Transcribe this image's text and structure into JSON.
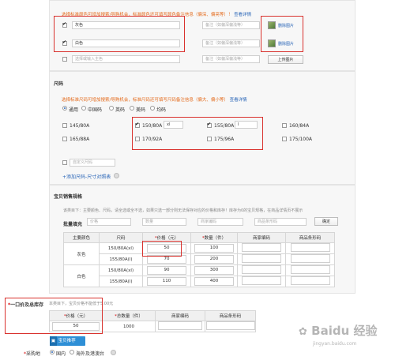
{
  "color_section": {
    "hint_text": "选择标准颜色可增加搜索/导购机会，标准颜色还可填写颜色备注信息（偏深、偏亮等）！",
    "hint_link": "查看详情",
    "rows": [
      {
        "checked": true,
        "name": "灰色",
        "remark_placeholder": "备注（如偏深偏浅等）",
        "image_label": "删除图片"
      },
      {
        "checked": true,
        "name": "白色",
        "remark_placeholder": "备注（如偏深偏浅等）",
        "image_label": "删除图片"
      },
      {
        "checked": false,
        "name": "选择或输入主色",
        "remark_placeholder": "备注（如偏深偏浅等）",
        "image_label": "上传图片"
      }
    ]
  },
  "size_section": {
    "title": "尺码",
    "hint_text": "选择标准尺码可增加搜索/导购机会，标准尺码还可填写尺码备注信息（偏大、偏小等）",
    "hint_link": "查看详情",
    "radios": [
      {
        "label": "通用",
        "checked": true
      },
      {
        "label": "中国码",
        "checked": false
      },
      {
        "label": "英码",
        "checked": false
      },
      {
        "label": "美码",
        "checked": false
      },
      {
        "label": "均码",
        "checked": false
      }
    ],
    "sizes": [
      {
        "label": "145/80A",
        "checked": false
      },
      {
        "label": "150/80A",
        "checked": true,
        "remark": "xl"
      },
      {
        "label": "155/80A",
        "checked": true,
        "remark": "l"
      },
      {
        "label": "160/84A",
        "checked": false
      },
      {
        "label": "165/88A",
        "checked": false
      },
      {
        "label": "170/92A",
        "checked": false
      },
      {
        "label": "175/96A",
        "checked": false
      },
      {
        "label": "175/100A",
        "checked": false
      }
    ],
    "custom_label": "自定义尺码",
    "add_link": "+添加尺码-尺寸对照表"
  },
  "sale_spec": {
    "title": "宝贝销售规格",
    "desc": "该类目下：主要颜色、尺码，请全选或全不选，如果只选一部分则无法保存对应的价格和库存！库存为0的宝贝规格，在商品详情页不展示",
    "batch_label": "批量填充",
    "batch_price_placeholder": "价格",
    "batch_qty_placeholder": "数量",
    "batch_code_placeholder": "商家编码",
    "batch_barcode_placeholder": "商品条形码",
    "confirm_label": "确定",
    "headers": [
      "主要颜色",
      "尺码",
      "价格（元）",
      "数量（件）",
      "商家编码",
      "商品条形码"
    ],
    "rows": [
      {
        "color": "灰色",
        "size": "150/80A(xl)",
        "price": "50",
        "qty": "100"
      },
      {
        "color": "",
        "size": "155/80A(l)",
        "price": "70",
        "qty": "200"
      },
      {
        "color": "白色",
        "size": "150/80A(xl)",
        "price": "90",
        "qty": "300"
      },
      {
        "color": "",
        "size": "155/80A(l)",
        "price": "110",
        "qty": "400"
      }
    ]
  },
  "price_stock": {
    "title": "一口价及总库存",
    "note": "本类目下，宝贝价格不能低于5.00元",
    "headers": [
      "价格（元）",
      "总数量（件）",
      "商家编码",
      "商品条形码"
    ],
    "price": "50",
    "total_qty": "1000"
  },
  "smart_button": "宝贝推荐",
  "purchase": {
    "label": "采购地",
    "options": [
      {
        "label": "国内",
        "checked": true
      },
      {
        "label": "海外及港澳台",
        "checked": false
      }
    ]
  },
  "watermark": "Baidu 经验",
  "watermark_url": "jingyan.baidu.com"
}
